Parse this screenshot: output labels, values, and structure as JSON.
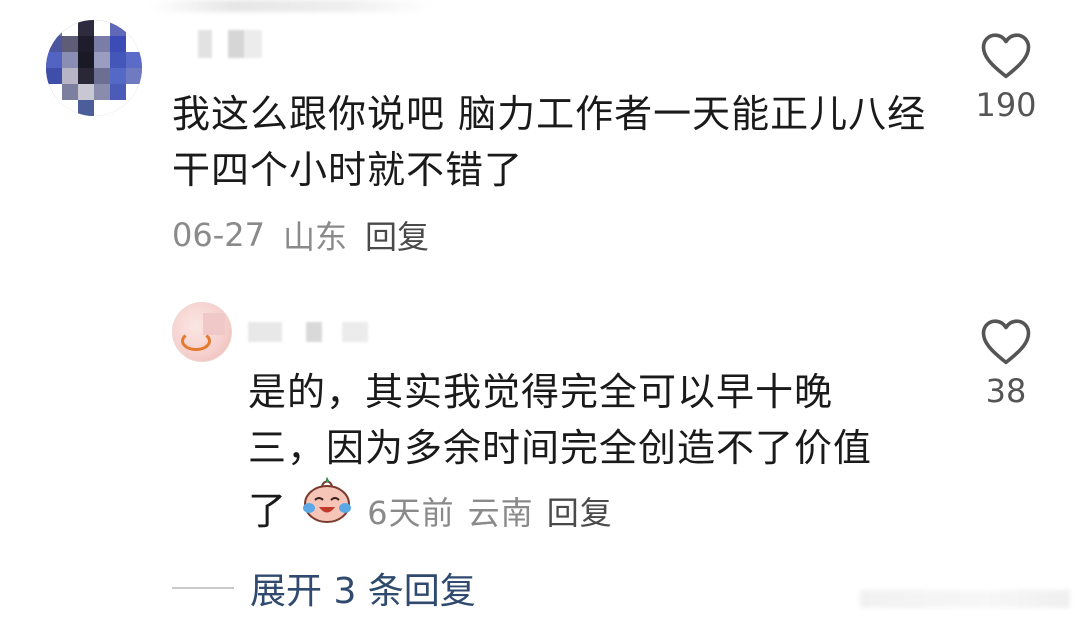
{
  "comment": {
    "text": "我这么跟你说吧 脑力工作者一天能正儿八经干四个小时就不错了",
    "date": "06-27",
    "location": "山东",
    "reply_label": "回复",
    "likes": "190",
    "icons": {
      "like": "heart-outline-icon",
      "avatar": "avatar"
    }
  },
  "reply": {
    "line1": "是的，其实我觉得完全可以早十晚",
    "line2": "三，因为多余时间完全创造不了价值",
    "line3": "了",
    "date": "6天前",
    "location": "云南",
    "reply_label": "回复",
    "likes": "38",
    "icons": {
      "like": "heart-outline-icon",
      "emoji": "crying-laughing-emoji-icon"
    }
  },
  "expand_replies": "展开 3 条回复"
}
